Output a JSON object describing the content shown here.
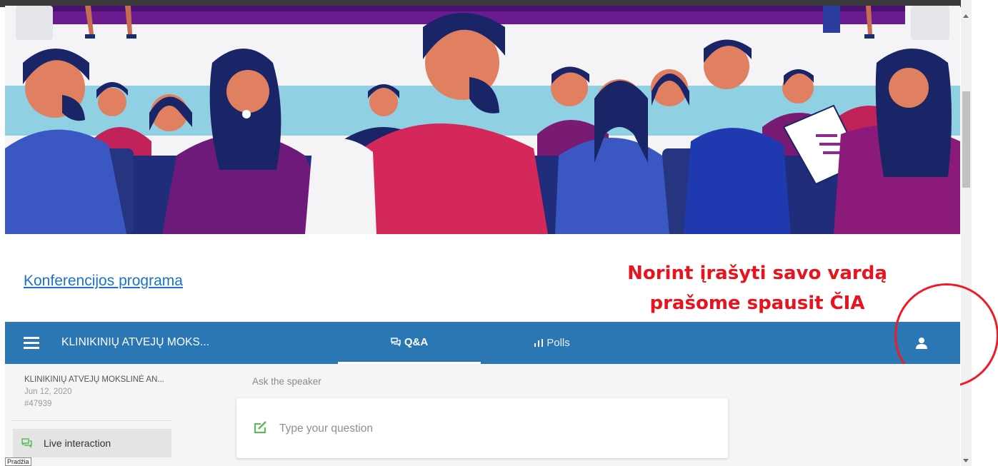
{
  "banner": {
    "image_alt": "Conference audience illustration"
  },
  "links": {
    "program": "Konferencijos programa"
  },
  "annotation": {
    "line1": "Norint įrašyti savo vardą",
    "line2": "prašome spausit ČIA"
  },
  "appbar": {
    "menu_icon": "hamburger-menu-icon",
    "title": "KLINIKINIŲ ATVEJŲ MOKS...",
    "tabs": [
      {
        "label": "Q&A",
        "icon": "chat-bubbles-icon",
        "active": true
      },
      {
        "label": "Polls",
        "icon": "bar-chart-icon",
        "active": false
      }
    ],
    "user_icon": "person-icon"
  },
  "sidebar": {
    "event_name": "KLINIKINIŲ ATVEJŲ MOKSLINĖ AN...",
    "event_date": "Jun 12, 2020",
    "event_code": "#47939",
    "items": [
      {
        "label": "Live interaction",
        "icon": "chat-bubbles-icon"
      }
    ]
  },
  "qa": {
    "ask_label": "Ask the speaker",
    "input_placeholder": "Type your question",
    "input_value": ""
  },
  "status_tooltip": "Pradžia",
  "colors": {
    "appbar": "#2a77b3",
    "link": "#1a73c8",
    "annotation": "#e8131c",
    "accent_green": "#5cb85c"
  }
}
